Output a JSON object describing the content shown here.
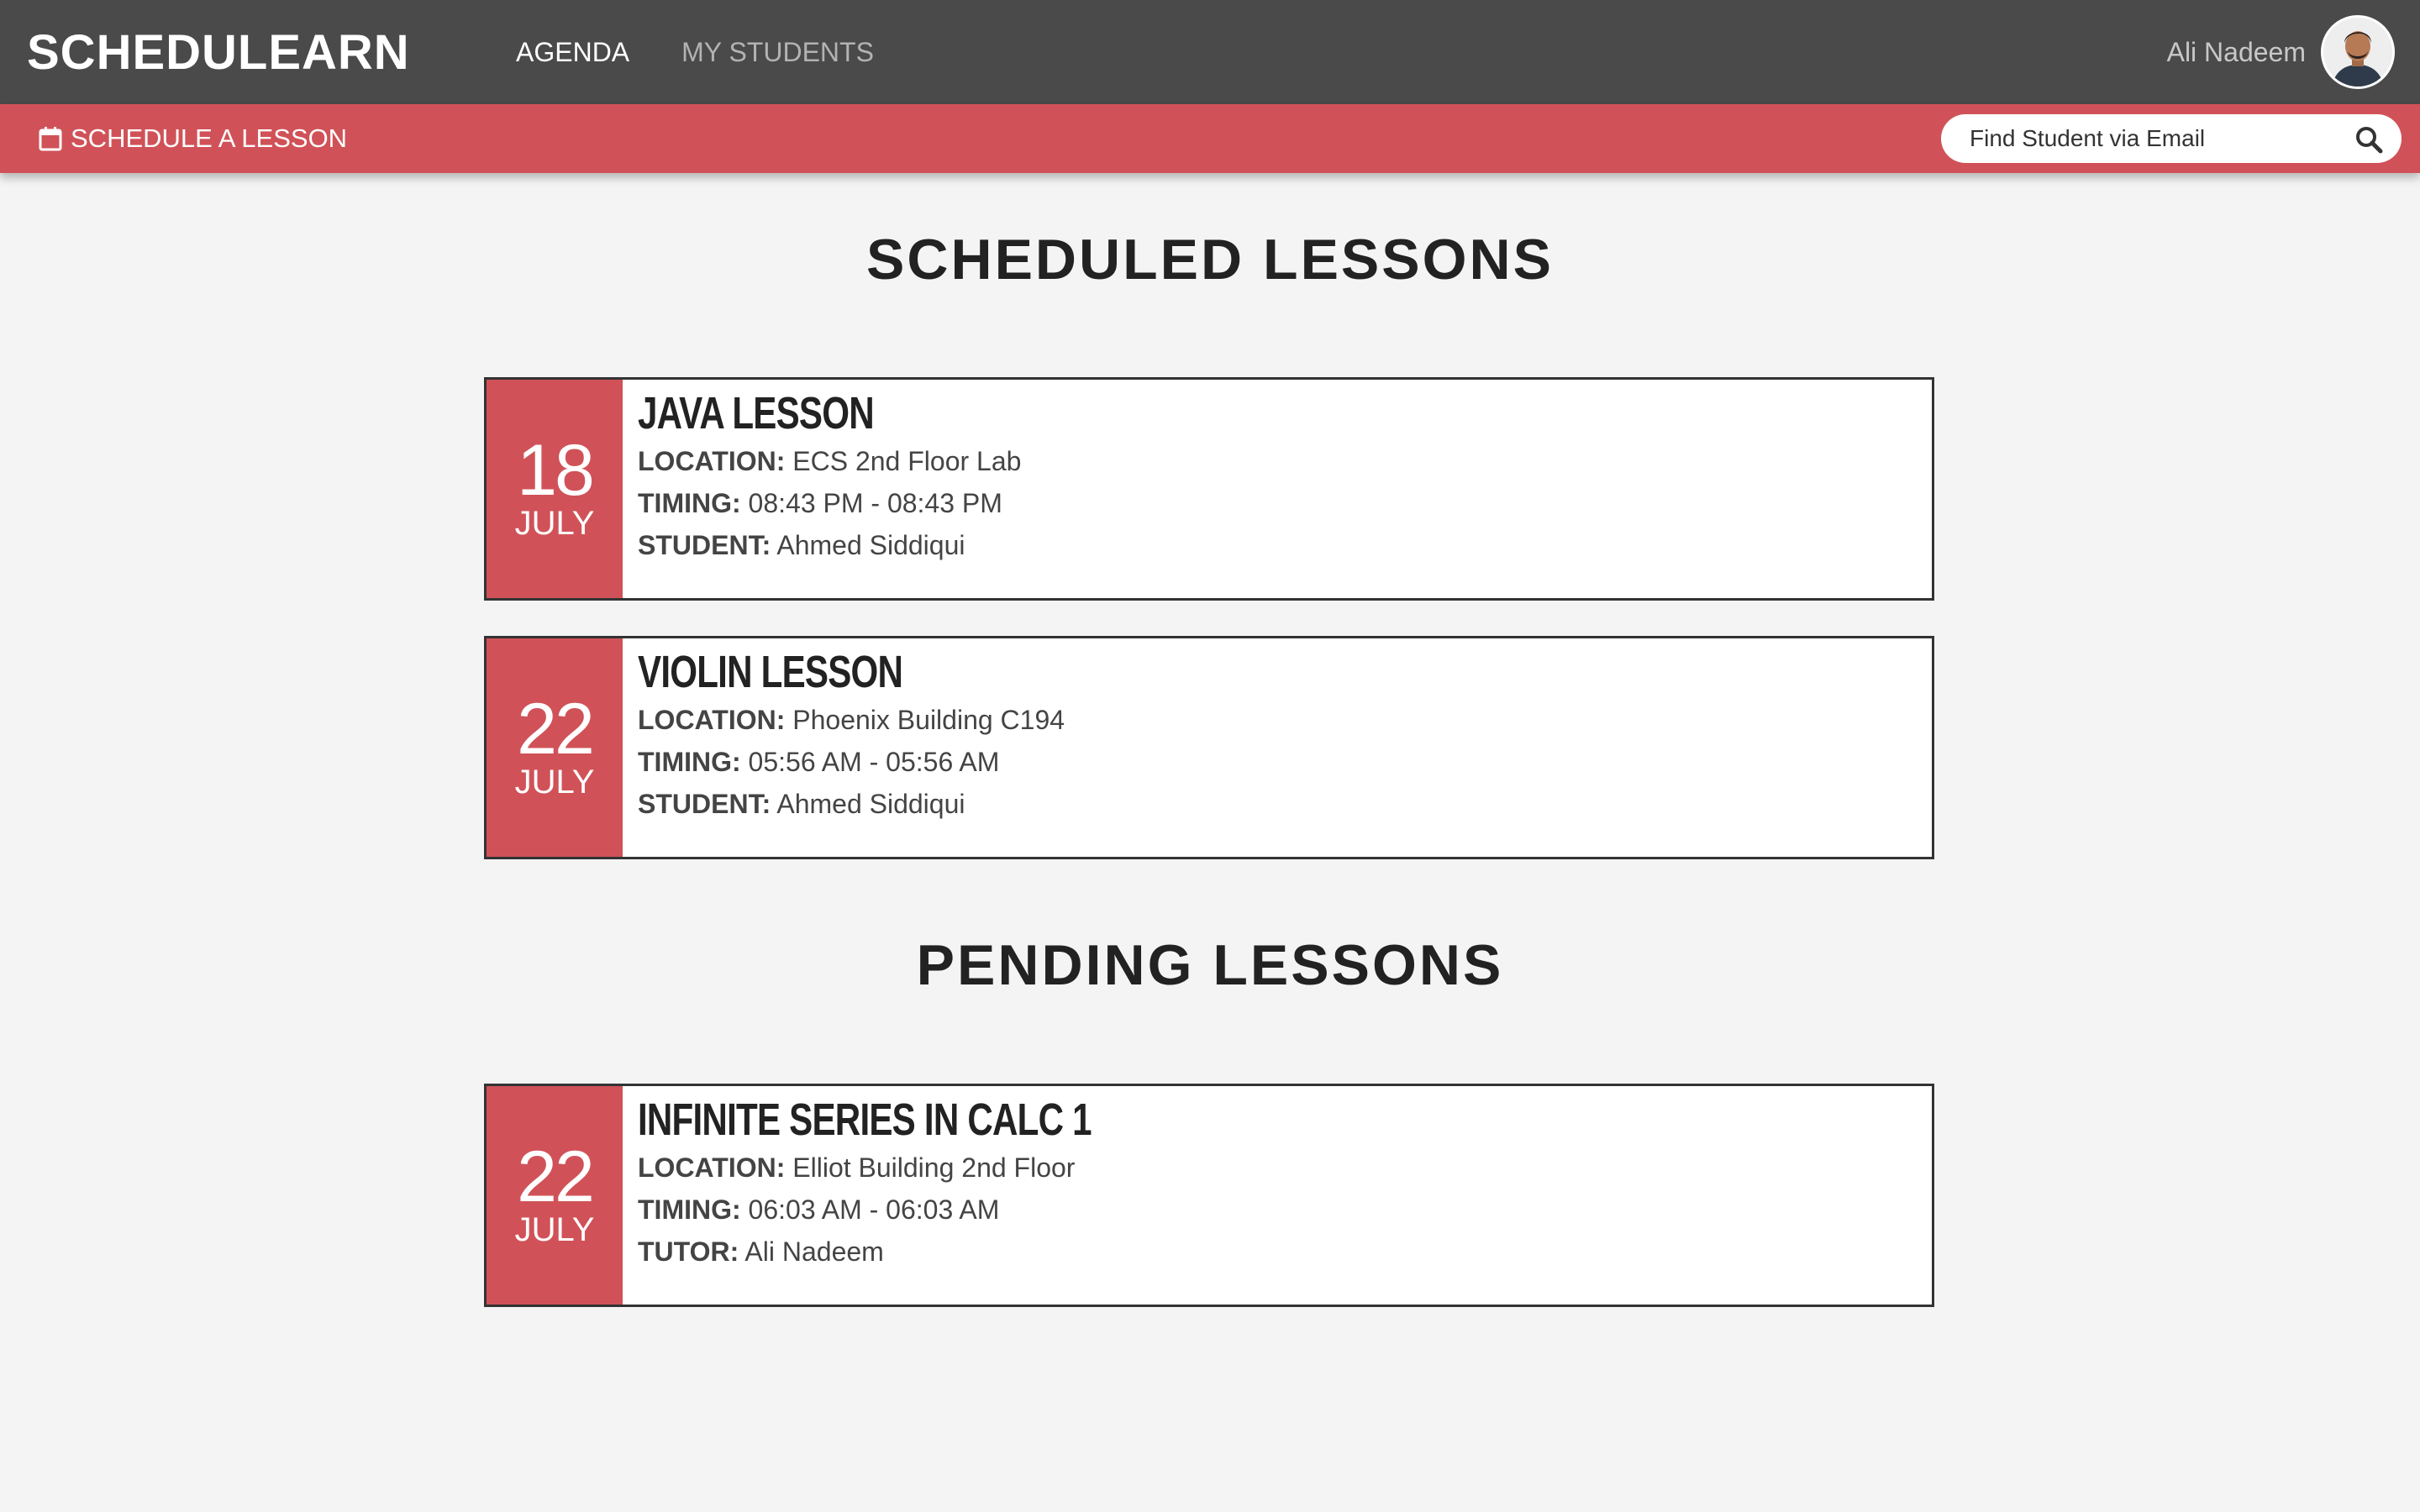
{
  "brand": "SCHEDULEARN",
  "nav": {
    "agenda": "AGENDA",
    "my_students": "MY STUDENTS"
  },
  "user": {
    "name": "Ali Nadeem",
    "avatar": "avatar-photo"
  },
  "actions": {
    "schedule_label": "SCHEDULE A LESSON",
    "schedule_icon": "calendar-icon",
    "search_placeholder": "Find Student via Email",
    "search_icon": "search-icon"
  },
  "sections": {
    "scheduled_title": "SCHEDULED LESSONS",
    "pending_title": "PENDING LESSONS"
  },
  "scheduled": [
    {
      "day": "18",
      "month": "JULY",
      "title": "JAVA LESSON",
      "location_label": "LOCATION:",
      "location": "ECS 2nd Floor Lab",
      "timing_label": "TIMING:",
      "timing": "08:43 PM - 08:43 PM",
      "person_label": "STUDENT:",
      "person": "Ahmed Siddiqui"
    },
    {
      "day": "22",
      "month": "JULY",
      "title": "VIOLIN LESSON",
      "location_label": "LOCATION:",
      "location": "Phoenix Building C194",
      "timing_label": "TIMING:",
      "timing": "05:56 AM - 05:56 AM",
      "person_label": "STUDENT:",
      "person": "Ahmed Siddiqui"
    }
  ],
  "pending": [
    {
      "day": "22",
      "month": "JULY",
      "title": "INFINITE SERIES IN CALC 1",
      "location_label": "LOCATION:",
      "location": "Elliot Building 2nd Floor",
      "timing_label": "TIMING:",
      "timing": "06:03 AM - 06:03 AM",
      "person_label": "TUTOR:",
      "person": "Ali Nadeem"
    }
  ],
  "colors": {
    "topbar": "#4a4a4a",
    "accent": "#d05258",
    "background": "#f4f4f4"
  }
}
